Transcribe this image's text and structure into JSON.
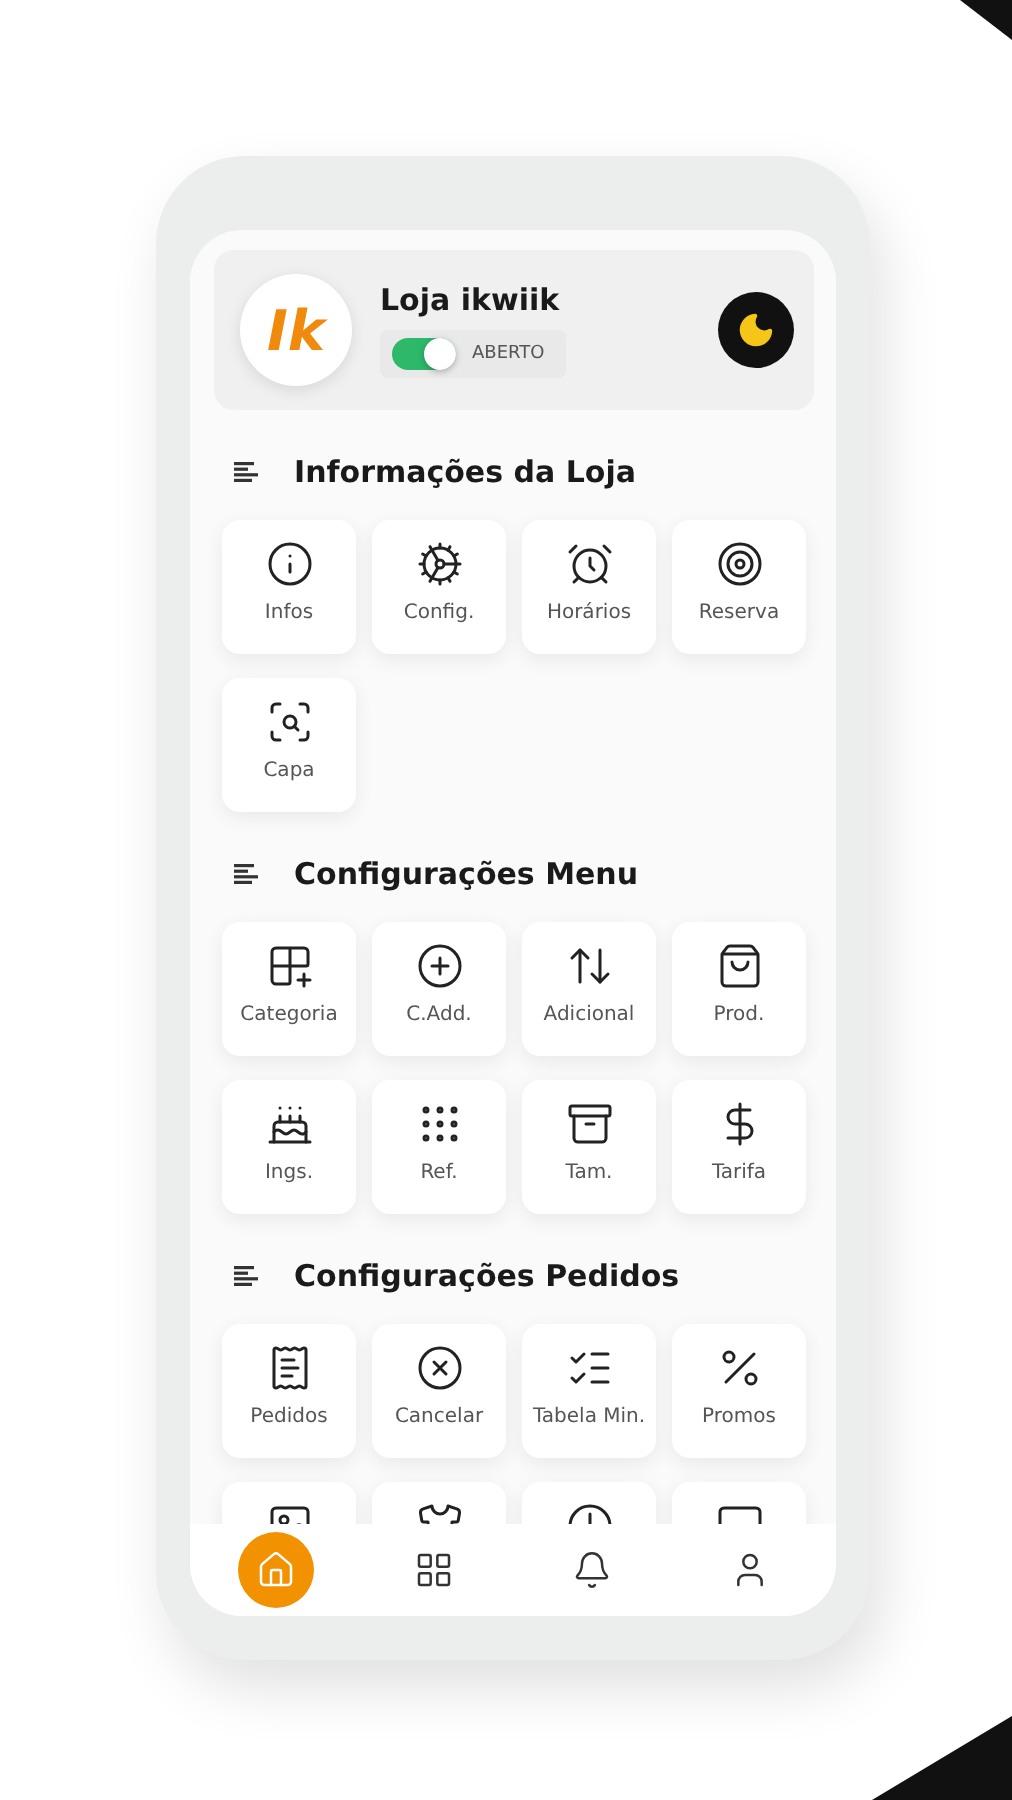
{
  "header": {
    "logo_text": "Ik",
    "store_name": "Loja ikwiik",
    "status_toggle": {
      "on": true,
      "label": "ABERTO"
    },
    "theme_button": {
      "dark": true
    }
  },
  "sections": [
    {
      "title": "Informações da Loja",
      "items": [
        {
          "kind": "tile",
          "label": "Infos"
        },
        {
          "kind": "tile",
          "label": "Config."
        },
        {
          "kind": "tile",
          "label": "Horários"
        },
        {
          "kind": "tile",
          "label": "Reserva"
        },
        {
          "kind": "tile",
          "label": "Capa"
        }
      ]
    },
    {
      "title": "Configurações Menu",
      "items": [
        {
          "kind": "tile",
          "label": "Categoria"
        },
        {
          "kind": "tile",
          "label": "C.Add."
        },
        {
          "kind": "tile",
          "label": "Adicional"
        },
        {
          "kind": "tile",
          "label": "Prod."
        },
        {
          "kind": "tile",
          "label": "Ings."
        },
        {
          "kind": "tile",
          "label": "Ref."
        },
        {
          "kind": "tile",
          "label": "Tam."
        },
        {
          "kind": "tile",
          "label": "Tarifa"
        }
      ]
    },
    {
      "title": "Configurações Pedidos",
      "items": [
        {
          "kind": "tile",
          "label": "Pedidos"
        },
        {
          "kind": "tile",
          "label": "Cancelar"
        },
        {
          "kind": "tile",
          "label": "Tabela Min."
        },
        {
          "kind": "tile",
          "label": "Promos"
        },
        {
          "kind": "clipped"
        },
        {
          "kind": "clipped"
        },
        {
          "kind": "clipped"
        },
        {
          "kind": "clipped"
        }
      ]
    }
  ],
  "bottom_nav": [
    {
      "selected": true
    },
    {
      "selected": false
    },
    {
      "selected": false
    },
    {
      "selected": false
    }
  ]
}
